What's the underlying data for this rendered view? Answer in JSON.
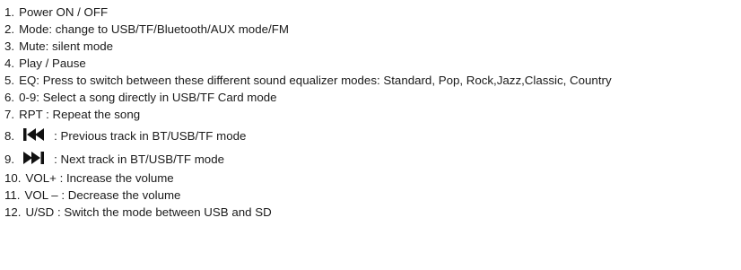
{
  "items": [
    {
      "number": "1.",
      "text": "Power ON / OFF"
    },
    {
      "number": "2.",
      "text": "Mode: change to USB/TF/Bluetooth/AUX mode/FM"
    },
    {
      "number": "3.",
      "text": "Mute: silent mode"
    },
    {
      "number": "4.",
      "text": "Play / Pause"
    },
    {
      "number": "5.",
      "text": "EQ: Press to switch between these different sound equalizer modes: Standard, Pop, Rock,Jazz,Classic, Country"
    },
    {
      "number": "6.",
      "text": "0-9: Select a song directly in USB/TF Card mode"
    },
    {
      "number": "7.",
      "text": "RPT : Repeat the song"
    },
    {
      "number": "8.",
      "icon": "previous-track-icon",
      "text": ": Previous track in BT/USB/TF mode"
    },
    {
      "number": "9.",
      "icon": "next-track-icon",
      "text": ": Next track in BT/USB/TF mode"
    },
    {
      "number": "10.",
      "text": "VOL+ : Increase the volume"
    },
    {
      "number": "11.",
      "text": "VOL – : Decrease the volume"
    },
    {
      "number": "12.",
      "text": "U/SD : Switch the mode between USB and SD"
    }
  ]
}
